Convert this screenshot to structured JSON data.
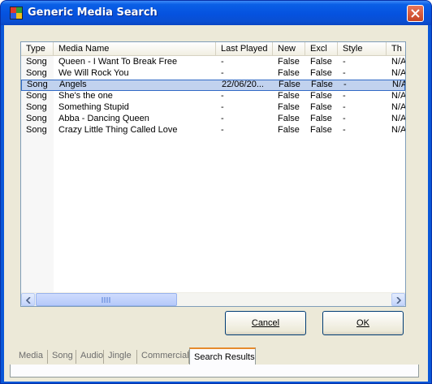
{
  "window": {
    "title": "Generic Media Search",
    "icon": "app-icon",
    "close_icon": "close-icon"
  },
  "list": {
    "columns": [
      "Type",
      "Media Name",
      "Last Played",
      "New",
      "Excl",
      "Style",
      "Th"
    ],
    "rows": [
      [
        "Song",
        "Queen - I Want To Break Free",
        "-",
        "False",
        "False",
        "-",
        "N/A"
      ],
      [
        "Song",
        "We Will Rock You",
        "-",
        "False",
        "False",
        "-",
        "N/A"
      ],
      [
        "Song",
        "Angels",
        "22/06/20...",
        "False",
        "False",
        "-",
        "N/A"
      ],
      [
        "Song",
        "She's the one",
        "-",
        "False",
        "False",
        "-",
        "N/A"
      ],
      [
        "Song",
        "Something Stupid",
        "-",
        "False",
        "False",
        "-",
        "N/A"
      ],
      [
        "Song",
        "Abba - Dancing Queen",
        "-",
        "False",
        "False",
        "-",
        "N/A"
      ],
      [
        "Song",
        "Crazy Little Thing Called Love",
        "-",
        "False",
        "False",
        "-",
        "N/A"
      ]
    ],
    "selected_row": 2
  },
  "buttons": {
    "cancel": "Cancel",
    "ok": "OK"
  },
  "tabs": [
    "Media",
    "Song",
    "Audio",
    "Jingle",
    "Commercial",
    "Search Results"
  ],
  "active_tab": "Search Results"
}
